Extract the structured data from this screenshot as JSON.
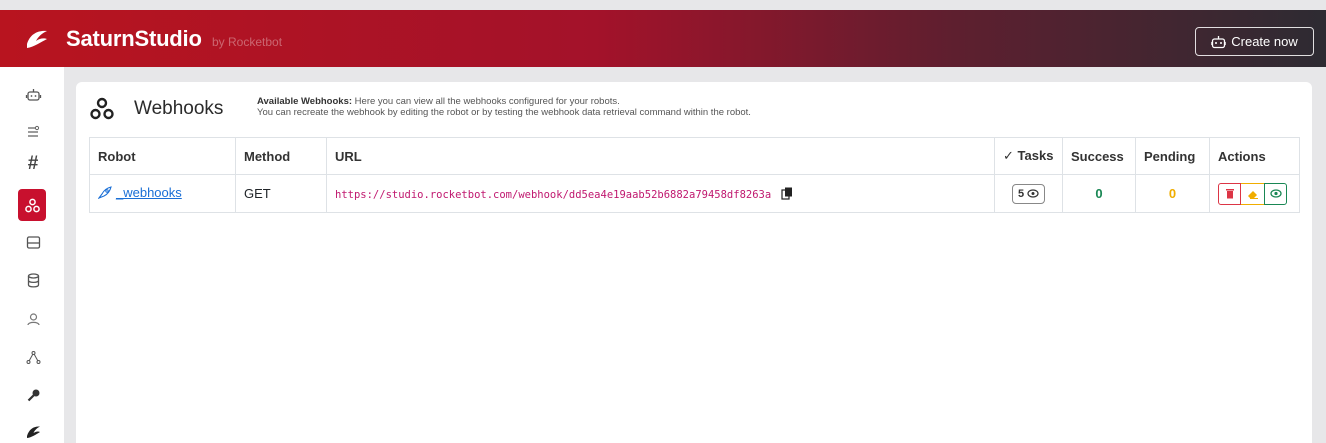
{
  "header": {
    "brand": "SaturnStudio",
    "brand_sub": "by Rocketbot",
    "create_button": "Create now",
    "logo_icon": "rocketbot-logo-icon"
  },
  "sidebar": {
    "items": [
      {
        "icon": "robot-icon"
      },
      {
        "icon": "toggles-icon"
      },
      {
        "icon": "hash-icon"
      },
      {
        "icon": "webhooks-icon",
        "active": true
      },
      {
        "icon": "window-icon"
      },
      {
        "icon": "database-icon"
      },
      {
        "icon": "users-icon"
      },
      {
        "icon": "diagram-icon"
      },
      {
        "icon": "key-icon"
      },
      {
        "icon": "rocketbot-icon"
      }
    ]
  },
  "page": {
    "title": "Webhooks",
    "info_bold": "Available Webhooks:",
    "info_line1": " Here you can view all the webhooks configured for your robots.",
    "info_line2": "You can recreate the webhook by editing the robot or by testing the webhook data retrieval command within the robot."
  },
  "table": {
    "headers": {
      "robot": "Robot",
      "method": "Method",
      "url": "URL",
      "tasks": "Tasks",
      "success": "Success",
      "pending": "Pending",
      "actions": "Actions"
    },
    "rows": [
      {
        "robot": "_webhooks",
        "method": "GET",
        "url": "https://studio.rocketbot.com/webhook/dd5ea4e19aab52b6882a79458df8263a",
        "tasks": "5",
        "success": "0",
        "pending": "0"
      }
    ]
  },
  "colors": {
    "accent": "#c8102e",
    "success": "#198754",
    "pending": "#f0ad00",
    "danger": "#dc3545",
    "url": "#c0186f"
  }
}
